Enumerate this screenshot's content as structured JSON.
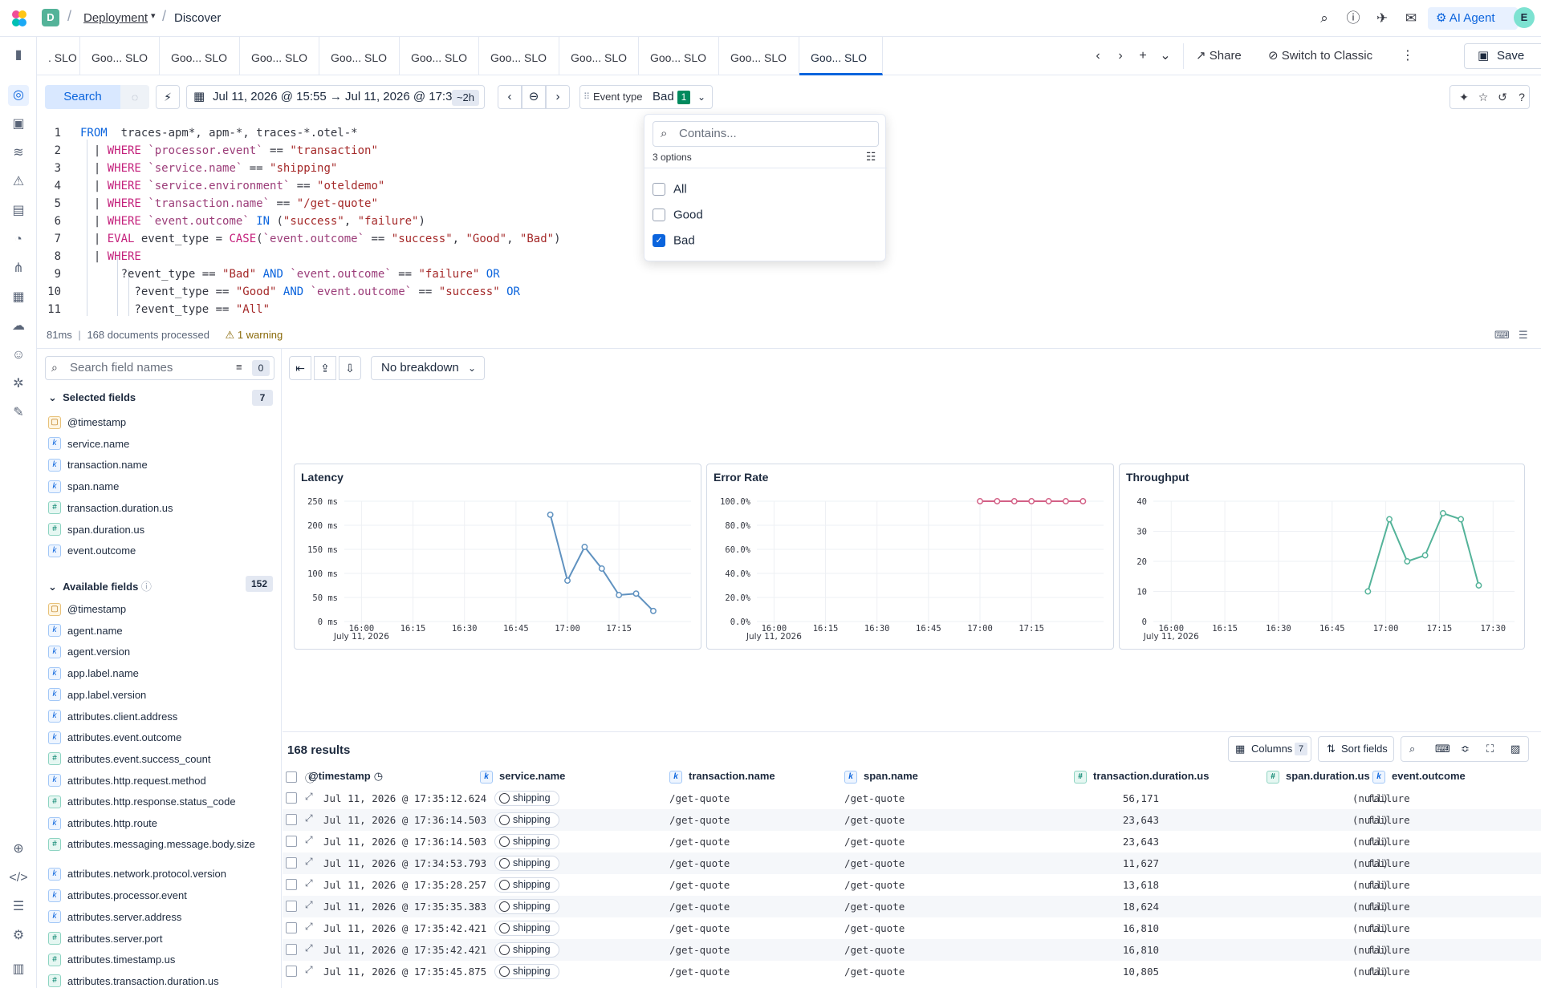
{
  "topbar": {
    "space": "D",
    "breadcrumb_app": "Deployment",
    "breadcrumb_page": "Discover",
    "ai_agent": "AI Agent",
    "user_initial": "E"
  },
  "tabs": {
    "items": [
      ". SLO",
      "Goo... SLO",
      "Goo... SLO",
      "Goo... SLO",
      "Goo... SLO",
      "Goo... SLO",
      "Goo... SLO",
      "Goo... SLO",
      "Goo... SLO",
      "Goo... SLO",
      "Goo... SLO"
    ],
    "share": "Share",
    "switch_classic": "Switch to Classic",
    "save": "Save"
  },
  "querybar": {
    "search": "Search",
    "date_range": "Jul 11, 2026 @ 15:55 → Jul 11, 2026 @ 17:36",
    "date_badge": "~2h",
    "event_type_label": "Event type",
    "event_type_value": "Bad",
    "event_type_count": "1"
  },
  "editor": {
    "lines": [
      "1",
      "2",
      "3",
      "4",
      "5",
      "6",
      "7",
      "8",
      "9",
      "10",
      "11"
    ]
  },
  "status": {
    "time": "81ms",
    "docs": "168 documents processed",
    "warning": "1 warning"
  },
  "popover": {
    "placeholder": "Contains...",
    "count": "3 options",
    "options": [
      {
        "label": "All",
        "checked": false
      },
      {
        "label": "Good",
        "checked": false
      },
      {
        "label": "Bad",
        "checked": true
      }
    ]
  },
  "sidebar": {
    "search_placeholder": "Search field names",
    "filter_count": "0",
    "selected_title": "Selected fields",
    "selected_count": "7",
    "selected": [
      {
        "type": "date",
        "name": "@timestamp"
      },
      {
        "type": "k",
        "name": "service.name"
      },
      {
        "type": "k",
        "name": "transaction.name"
      },
      {
        "type": "k",
        "name": "span.name"
      },
      {
        "type": "num",
        "name": "transaction.duration.us"
      },
      {
        "type": "num",
        "name": "span.duration.us"
      },
      {
        "type": "k",
        "name": "event.outcome"
      }
    ],
    "available_title": "Available fields",
    "available_count": "152",
    "available": [
      {
        "type": "date",
        "name": "@timestamp"
      },
      {
        "type": "k",
        "name": "agent.name"
      },
      {
        "type": "k",
        "name": "agent.version"
      },
      {
        "type": "k",
        "name": "app.label.name"
      },
      {
        "type": "k",
        "name": "app.label.version"
      },
      {
        "type": "k",
        "name": "attributes.client.address"
      },
      {
        "type": "k",
        "name": "attributes.event.outcome"
      },
      {
        "type": "num",
        "name": "attributes.event.success_count"
      },
      {
        "type": "k",
        "name": "attributes.http.request.method"
      },
      {
        "type": "num",
        "name": "attributes.http.response.status_code"
      },
      {
        "type": "k",
        "name": "attributes.http.route"
      },
      {
        "type": "num",
        "name": "attributes.messaging.message.body.size"
      },
      {
        "type": "k",
        "name": "attributes.network.protocol.version"
      },
      {
        "type": "k",
        "name": "attributes.processor.event"
      },
      {
        "type": "k",
        "name": "attributes.server.address"
      },
      {
        "type": "num",
        "name": "attributes.server.port"
      },
      {
        "type": "num",
        "name": "attributes.timestamp.us"
      },
      {
        "type": "num",
        "name": "attributes.transaction.duration.us"
      }
    ]
  },
  "toolbar": {
    "breakdown": "No breakdown"
  },
  "chart_data": [
    {
      "type": "line",
      "title": "Latency",
      "color": "#6092c0",
      "x_ticks": [
        "16:00",
        "16:15",
        "16:30",
        "16:45",
        "17:00",
        "17:15"
      ],
      "x_sub": "July 11, 2026",
      "y_ticks": [
        "250 ms",
        "200 ms",
        "150 ms",
        "100 ms",
        "50 ms",
        "0 ms"
      ],
      "ylim": [
        0,
        250
      ],
      "x_minutes": [
        1015,
        1020,
        1025,
        1030,
        1035,
        1040,
        1045
      ],
      "values": [
        222,
        85,
        155,
        110,
        55,
        58,
        22
      ]
    },
    {
      "type": "line",
      "title": "Error Rate",
      "color": "#d36086",
      "x_ticks": [
        "16:00",
        "16:15",
        "16:30",
        "16:45",
        "17:00",
        "17:15"
      ],
      "x_sub": "July 11, 2026",
      "y_ticks": [
        "100.0%",
        "80.0%",
        "60.0%",
        "40.0%",
        "20.0%",
        "0.0%"
      ],
      "ylim": [
        0,
        100
      ],
      "x_minutes": [
        1020,
        1025,
        1030,
        1035,
        1040,
        1045,
        1050
      ],
      "values": [
        100,
        100,
        100,
        100,
        100,
        100,
        100
      ]
    },
    {
      "type": "line",
      "title": "Throughput",
      "color": "#54b399",
      "x_ticks": [
        "16:00",
        "16:15",
        "16:30",
        "16:45",
        "17:00",
        "17:15",
        "17:30"
      ],
      "x_sub": "July 11, 2026",
      "y_ticks": [
        "40",
        "30",
        "20",
        "10",
        "0"
      ],
      "ylim": [
        0,
        40
      ],
      "x_minutes": [
        1015,
        1021,
        1026,
        1031,
        1036,
        1041,
        1046
      ],
      "values": [
        10,
        34,
        20,
        22,
        36,
        34,
        12
      ]
    }
  ],
  "results": {
    "count": "168 results",
    "columns_btn": "Columns",
    "columns_count": "7",
    "sort_btn": "Sort fields",
    "headers": [
      "@timestamp",
      "service.name",
      "transaction.name",
      "span.name",
      "transaction.duration.us",
      "span.duration.us",
      "event.outcome"
    ],
    "rows": [
      {
        "ts": "Jul 11, 2026 @ 17:35:12.624",
        "svc": "shipping",
        "tx": "/get-quote",
        "span": "/get-quote",
        "dur": "56,171",
        "sdur": "(null)",
        "out": "failure"
      },
      {
        "ts": "Jul 11, 2026 @ 17:36:14.503",
        "svc": "shipping",
        "tx": "/get-quote",
        "span": "/get-quote",
        "dur": "23,643",
        "sdur": "(null)",
        "out": "failure"
      },
      {
        "ts": "Jul 11, 2026 @ 17:36:14.503",
        "svc": "shipping",
        "tx": "/get-quote",
        "span": "/get-quote",
        "dur": "23,643",
        "sdur": "(null)",
        "out": "failure"
      },
      {
        "ts": "Jul 11, 2026 @ 17:34:53.793",
        "svc": "shipping",
        "tx": "/get-quote",
        "span": "/get-quote",
        "dur": "11,627",
        "sdur": "(null)",
        "out": "failure"
      },
      {
        "ts": "Jul 11, 2026 @ 17:35:28.257",
        "svc": "shipping",
        "tx": "/get-quote",
        "span": "/get-quote",
        "dur": "13,618",
        "sdur": "(null)",
        "out": "failure"
      },
      {
        "ts": "Jul 11, 2026 @ 17:35:35.383",
        "svc": "shipping",
        "tx": "/get-quote",
        "span": "/get-quote",
        "dur": "18,624",
        "sdur": "(null)",
        "out": "failure"
      },
      {
        "ts": "Jul 11, 2026 @ 17:35:42.421",
        "svc": "shipping",
        "tx": "/get-quote",
        "span": "/get-quote",
        "dur": "16,810",
        "sdur": "(null)",
        "out": "failure"
      },
      {
        "ts": "Jul 11, 2026 @ 17:35:42.421",
        "svc": "shipping",
        "tx": "/get-quote",
        "span": "/get-quote",
        "dur": "16,810",
        "sdur": "(null)",
        "out": "failure"
      },
      {
        "ts": "Jul 11, 2026 @ 17:35:45.875",
        "svc": "shipping",
        "tx": "/get-quote",
        "span": "/get-quote",
        "dur": "10,805",
        "sdur": "(null)",
        "out": "failure"
      }
    ]
  },
  "colors": {
    "accent": "#0b64dd",
    "success": "#008a5e",
    "latency": "#6092c0",
    "error": "#d36086",
    "throughput": "#54b399"
  }
}
